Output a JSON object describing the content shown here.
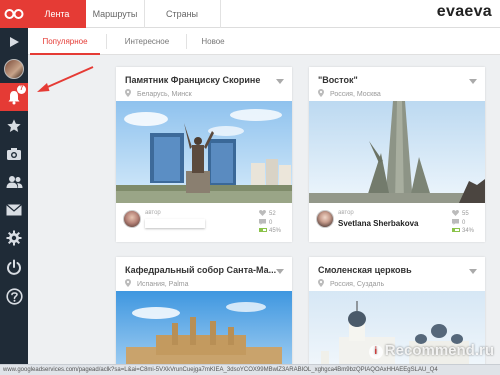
{
  "sidebar": {
    "logo_icon": "owl-eyes-logo",
    "items": [
      {
        "name": "play-icon"
      },
      {
        "name": "user-avatar"
      },
      {
        "name": "notifications-icon",
        "badge": "7"
      },
      {
        "name": "star-icon"
      },
      {
        "name": "camera-icon"
      },
      {
        "name": "users-icon"
      },
      {
        "name": "mail-icon"
      },
      {
        "name": "gear-icon"
      },
      {
        "name": "power-icon"
      },
      {
        "name": "help-icon"
      }
    ]
  },
  "topbar": {
    "tabs": [
      {
        "label": "Лента",
        "active": true
      },
      {
        "label": "Маршруты",
        "active": false
      },
      {
        "label": "Страны",
        "active": false
      }
    ],
    "brand": "evaeva"
  },
  "subtabs": [
    {
      "label": "Популярное",
      "active": true
    },
    {
      "label": "Интересное",
      "active": false
    },
    {
      "label": "Новое",
      "active": false
    }
  ],
  "cards": [
    {
      "title": "Памятник Франциску Скорине",
      "location": "Беларусь, Минск",
      "author_label": "автор",
      "author_name": "",
      "likes": "52",
      "comments": "0",
      "progress": "45%",
      "progress_value": 0.45
    },
    {
      "title": "\"Восток\"",
      "location": "Россия, Москва",
      "author_label": "автор",
      "author_name": "Svetlana Sherbakova",
      "likes": "55",
      "comments": "0",
      "progress": "34%",
      "progress_value": 0.34
    },
    {
      "title": "Кафедральный собор Санта-Ма...",
      "location": "Испания, Palma"
    },
    {
      "title": "Смоленская церковь",
      "location": "Россия, Суздаль"
    }
  ],
  "statusbar": {
    "url": "www.googleadservices.com/pagead/aclk?sa=L&ai=C8mi-5VXkVrunCuejga7mKIEA_3dsoYCOX99MBwlZ3ARABIOL_xghgca4Bm9bzQPIAQOAxHHAEEgSLAU_Q4"
  },
  "watermark": "Recommend.ru",
  "colors": {
    "accent": "#e53b35",
    "sidebar": "#1f2b37",
    "progress": "#8bc34a"
  }
}
